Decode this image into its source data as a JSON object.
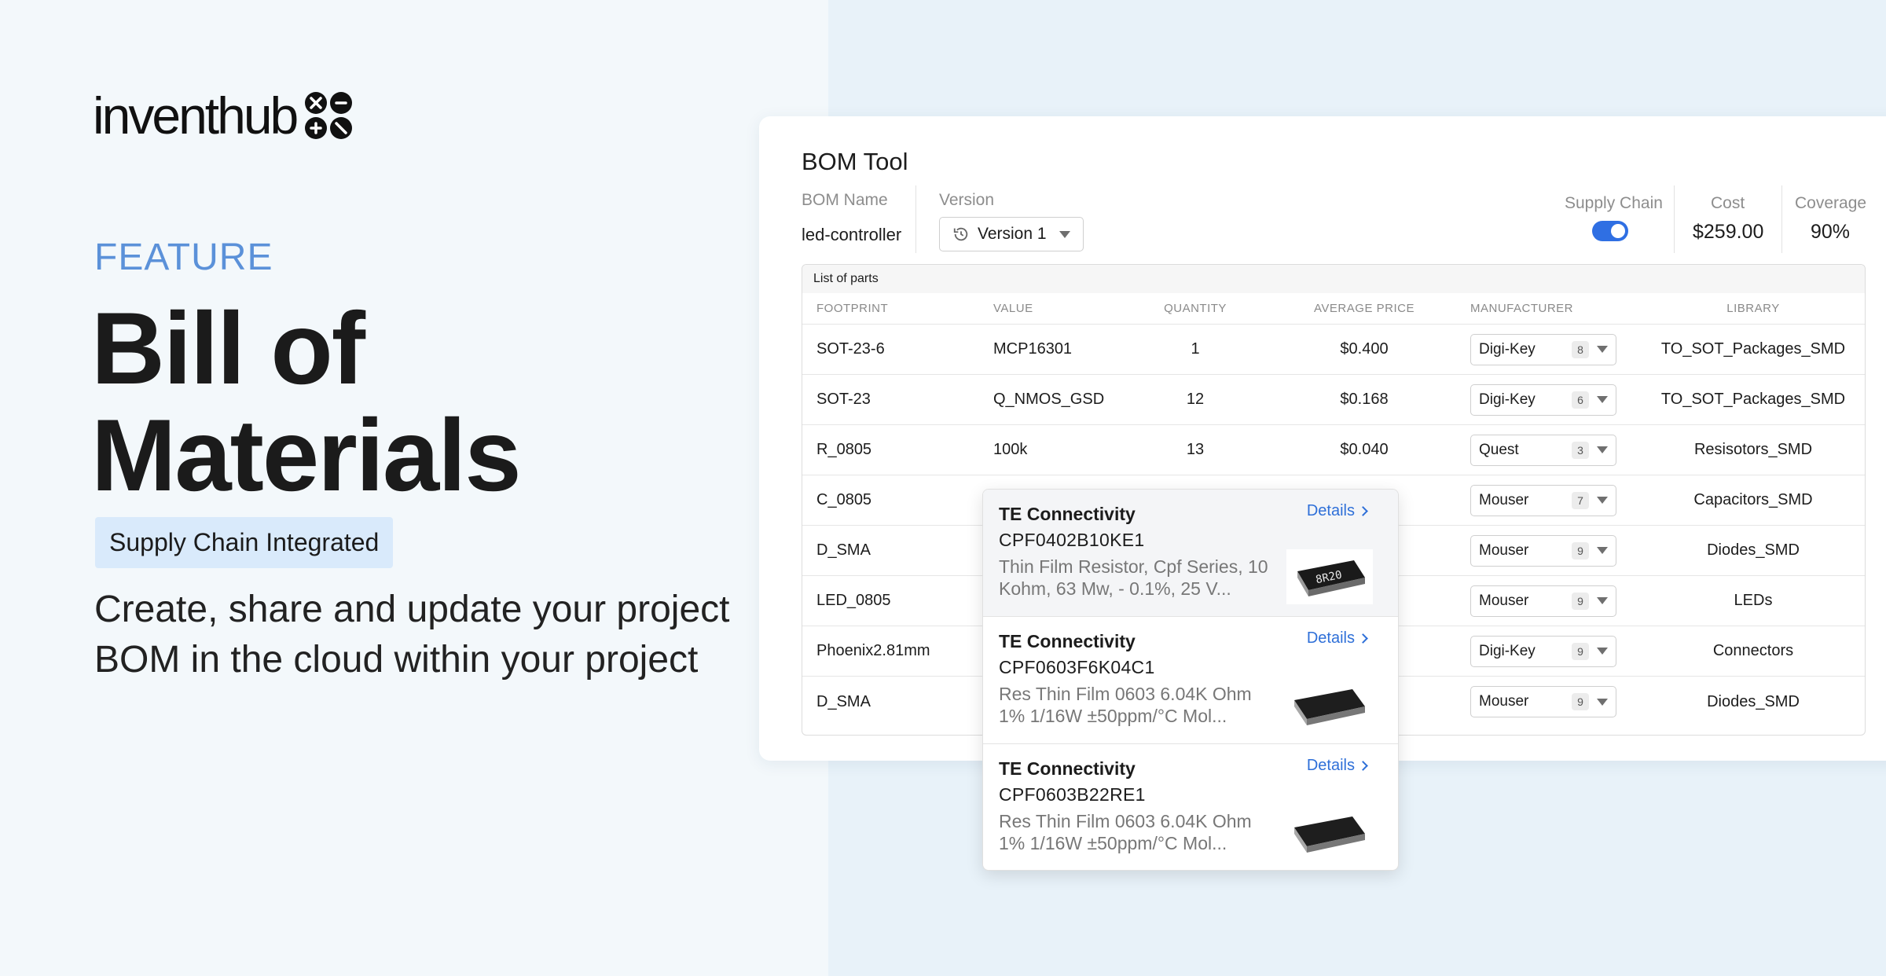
{
  "brand": {
    "logo_text": "inventhub"
  },
  "hero": {
    "eyebrow": "FEATURE",
    "headline_line1": "Bill of",
    "headline_line2": "Materials",
    "badge": "Supply Chain Integrated",
    "subline_line1": "Create, share and update your project",
    "subline_line2": "BOM in the cloud within your project"
  },
  "bom": {
    "title": "BOM Tool",
    "bom_name_label": "BOM Name",
    "bom_name_value": "led-controller",
    "version_label": "Version",
    "version_value": "Version 1",
    "supply_chain_label": "Supply Chain",
    "supply_chain_enabled": true,
    "cost_label": "Cost",
    "cost_value": "$259.00",
    "coverage_label": "Coverage",
    "coverage_value": "90%",
    "table_caption": "List of parts",
    "columns": {
      "footprint": "FOOTPRINT",
      "value": "VALUE",
      "quantity": "QUANTITY",
      "avg_price": "AVERAGE PRICE",
      "manufacturer": "MANUFACTURER",
      "library": "LIBRARY"
    },
    "rows": [
      {
        "footprint": "SOT-23-6",
        "value": "MCP16301",
        "quantity": "1",
        "price": "$0.400",
        "mfr": "Digi-Key",
        "mfr_count": "8",
        "library": "TO_SOT_Packages_SMD"
      },
      {
        "footprint": "SOT-23",
        "value": "Q_NMOS_GSD",
        "quantity": "12",
        "price": "$0.168",
        "mfr": "Digi-Key",
        "mfr_count": "6",
        "library": "TO_SOT_Packages_SMD"
      },
      {
        "footprint": "R_0805",
        "value": "100k",
        "quantity": "13",
        "price": "$0.040",
        "mfr": "Quest",
        "mfr_count": "3",
        "library": "Resisotors_SMD"
      },
      {
        "footprint": "C_0805",
        "value": "",
        "quantity": "",
        "price": "",
        "mfr": "Mouser",
        "mfr_count": "7",
        "library": "Capacitors_SMD"
      },
      {
        "footprint": "D_SMA",
        "value": "",
        "quantity": "",
        "price": "",
        "mfr": "Mouser",
        "mfr_count": "9",
        "library": "Diodes_SMD"
      },
      {
        "footprint": "LED_0805",
        "value": "",
        "quantity": "",
        "price": "",
        "mfr": "Mouser",
        "mfr_count": "9",
        "library": "LEDs"
      },
      {
        "footprint": "Phoenix2.81mm",
        "value": "",
        "quantity": "",
        "price": "",
        "mfr": "Digi-Key",
        "mfr_count": "9",
        "library": "Connectors"
      },
      {
        "footprint": "D_SMA",
        "value": "",
        "quantity": "",
        "price": "",
        "mfr": "Mouser",
        "mfr_count": "9",
        "library": "Diodes_SMD"
      }
    ]
  },
  "dropdown": {
    "details_label": "Details",
    "items": [
      {
        "mfr": "TE Connectivity",
        "part": "CPF0402B10KE1",
        "desc1": "Thin Film Resistor, Cpf Series, 10",
        "desc2": "Kohm, 63 Mw, - 0.1%, 25 V...",
        "image_label": "8R20"
      },
      {
        "mfr": "TE Connectivity",
        "part": "CPF0603F6K04C1",
        "desc1": "Res Thin Film 0603 6.04K Ohm",
        "desc2": "1% 1/16W ±50ppm/°C Mol..."
      },
      {
        "mfr": "TE Connectivity",
        "part": "CPF0603B22RE1",
        "desc1": "Res Thin Film 0603 6.04K Ohm",
        "desc2": "1% 1/16W ±50ppm/°C Mol..."
      }
    ]
  }
}
